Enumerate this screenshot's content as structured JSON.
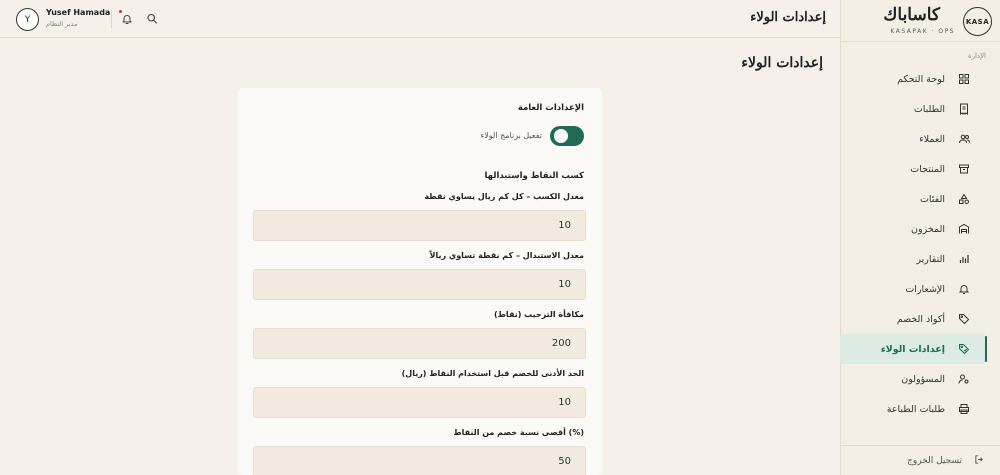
{
  "sidebar": {
    "logo_text": "KASA",
    "brand_name": "كاساباك",
    "brand_sub": "KASAPAK · OPS",
    "section_label": "الإدارة",
    "items": [
      {
        "label": "لوحة التحكم",
        "icon": "grid-icon"
      },
      {
        "label": "الطلبات",
        "icon": "receipt-icon"
      },
      {
        "label": "العملاء",
        "icon": "users-icon"
      },
      {
        "label": "المنتجات",
        "icon": "box-icon"
      },
      {
        "label": "الفئات",
        "icon": "shapes-icon"
      },
      {
        "label": "المخزون",
        "icon": "warehouse-icon"
      },
      {
        "label": "التقارير",
        "icon": "bar-chart-icon"
      },
      {
        "label": "الإشعارات",
        "icon": "bell-icon"
      },
      {
        "label": "أكواد الخصم",
        "icon": "tag-icon"
      },
      {
        "label": "إعدادات الولاء",
        "icon": "tag-settings-icon"
      },
      {
        "label": "المسؤولون",
        "icon": "user-gear-icon"
      },
      {
        "label": "طلبات الطباعة",
        "icon": "printer-icon"
      }
    ],
    "active_index": 9,
    "logout_label": "تسجيل الخروج"
  },
  "header": {
    "title": "إعدادات الولاء",
    "user_initial": "Y",
    "user_name": "Yusef Hamada",
    "user_role": "مدير النظام"
  },
  "main": {
    "page_title": "إعدادات الولاء",
    "general_title": "الإعدادات العامة",
    "toggle_label": "تفعيل برنامج الولاء",
    "toggle_on": true,
    "earn_title": "كسب النقاط واستبدالها",
    "fields": [
      {
        "label": "معدل الكسب – كل كم ريال يساوي نقطة",
        "value": "10"
      },
      {
        "label": "معدل الاستبدال – كم نقطة تساوي ريالاً",
        "value": "10"
      },
      {
        "label": "مكافأة الترحيب (نقاط)",
        "value": "200"
      },
      {
        "label": "الحد الأدنى للخصم قبل استخدام النقاط (ريال)",
        "value": "10"
      },
      {
        "label": "أقصى نسبة خصم من النقاط (%)",
        "value": "50"
      }
    ]
  },
  "colors": {
    "accent": "#1f6b55",
    "background": "#f5f1e8",
    "card": "#fbfaf6",
    "field": "#f1ecdf",
    "active_bg": "#dcece4"
  }
}
